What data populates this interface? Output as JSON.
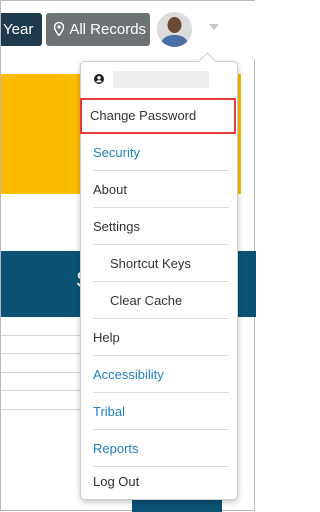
{
  "toolbar": {
    "year_label": "Year",
    "records_label": "All Records"
  },
  "background": {
    "header_text": "S"
  },
  "user_menu": {
    "items": [
      {
        "label": "Change Password",
        "style": "normal",
        "highlighted": true
      },
      {
        "label": "Security",
        "style": "link"
      },
      {
        "label": "About",
        "style": "normal"
      },
      {
        "label": "Settings",
        "style": "normal"
      },
      {
        "label": "Shortcut Keys",
        "style": "sub"
      },
      {
        "label": "Clear Cache",
        "style": "sub"
      },
      {
        "label": "Help",
        "style": "normal"
      },
      {
        "label": "Accessibility",
        "style": "link"
      },
      {
        "label": "Tribal",
        "style": "link"
      },
      {
        "label": "Reports",
        "style": "link"
      },
      {
        "label": "Log Out",
        "style": "normal"
      }
    ]
  },
  "colors": {
    "accent_yellow": "#fcbc00",
    "header_blue": "#0b5374",
    "link_blue": "#1f7fbf",
    "highlight_red": "#e23b3b"
  }
}
